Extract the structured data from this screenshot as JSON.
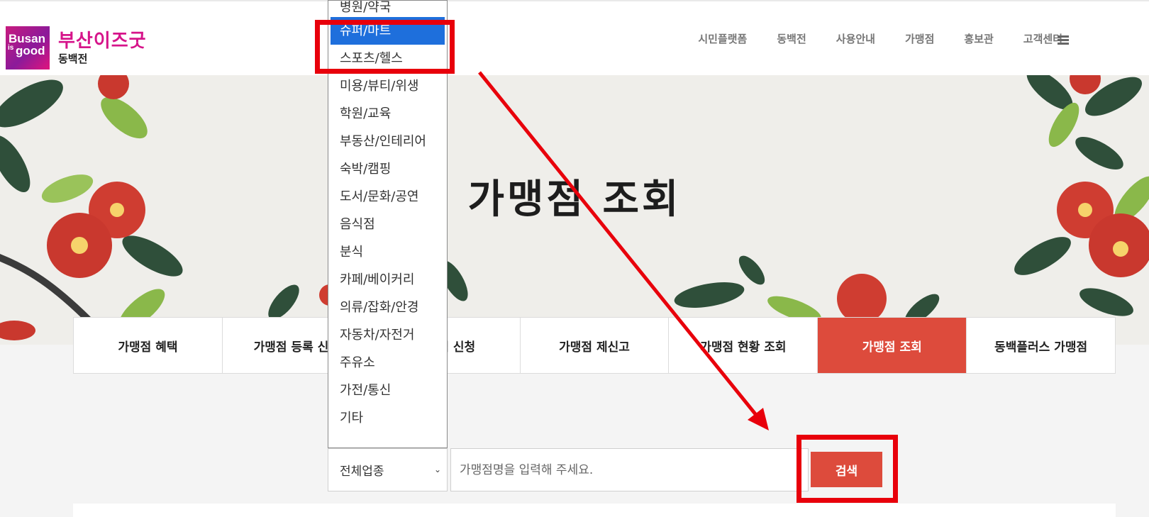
{
  "header": {
    "logo": {
      "line1": "Busan",
      "line2": "is",
      "line3": "good",
      "title": "부산이즈굿",
      "subtitle": "동백전"
    },
    "nav": [
      "시민플랫폼",
      "동백전",
      "사용안내",
      "가맹점",
      "홍보관",
      "고객센터"
    ]
  },
  "banner": {
    "title": "가맹점 조회"
  },
  "tabs": [
    {
      "label": "가맹점 혜택",
      "active": false
    },
    {
      "label": "가맹점 등록 신청",
      "active": false
    },
    {
      "label": "가맹점 신청",
      "active": false
    },
    {
      "label": "가맹점 제신고",
      "active": false
    },
    {
      "label": "가맹점 현황 조회",
      "active": false
    },
    {
      "label": "가맹점 조회",
      "active": true
    },
    {
      "label": "동백플러스 가맹점",
      "active": false
    }
  ],
  "search": {
    "category_selected": "전체업종",
    "placeholder": "가맹점명을 입력해 주세요.",
    "button_label": "검색"
  },
  "dropdown": {
    "items": [
      "병원/약국",
      "슈퍼/마트",
      "스포츠/헬스",
      "미용/뷰티/위생",
      "학원/교육",
      "부동산/인테리어",
      "숙박/캠핑",
      "도서/문화/공연",
      "음식점",
      "분식",
      "카페/베이커리",
      "의류/잡화/안경",
      "자동차/자전거",
      "주유소",
      "가전/통신",
      "기타"
    ],
    "highlighted": "슈퍼/마트"
  },
  "colors": {
    "accent": "#dd4b3c",
    "brand": "#d6148a",
    "selection": "#1e6fdc",
    "annotation": "#e8000b"
  },
  "icons": [
    "menu-icon",
    "chevron-down-icon",
    "camellia-flower"
  ]
}
